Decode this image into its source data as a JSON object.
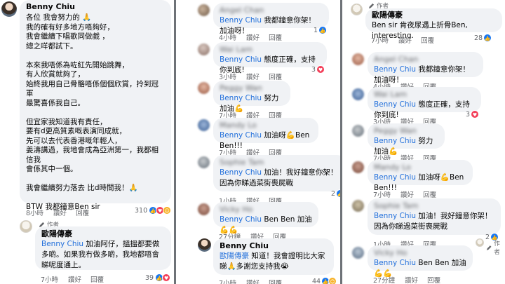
{
  "colors": {
    "mention": "#216fdb",
    "bubble": "#f0f2f5",
    "meta": "#65676b",
    "divider": "#6e7277"
  },
  "panel1": {
    "post": {
      "author": "Benny Chiu",
      "lines": [
        "各位 我會努力的 🙏",
        "我的確有好多地方唔夠好，",
        "我會繼續下唱歌同做戲 ，",
        "總之咩都試下。",
        "",
        "本來我唔係為咗紅先開始跳舞，",
        "有人欣賞就夠了，",
        "始終我用自己骨骼唔係個個欣賞，拎到冠軍",
        "最驚喜係我自己。",
        "",
        "但宜家我知道我有責任，",
        "要有d更高質素嘅表演同成就，",
        "先可以去代表香港嘅年輕人，",
        "姜濤講過，我地會成為亞洲第一，我都相信我",
        "會係其中一個。",
        "",
        "我會繼續努力落去 比d時間我！🙏",
        "",
        "BTW 我都鐘意Ben sir"
      ],
      "time": "8小時",
      "like": "讚好",
      "reply": "回覆",
      "count": "310"
    },
    "reply": {
      "badge": "作者",
      "name": "歐陽傳豪",
      "mention": "Benny Chiu",
      "text": " 加油阿仔，搵搵都要做多啲。如果我冇做多啲，我地都唔會睇呢度通上。",
      "time": "7小時",
      "like": "讚好",
      "reply": "回覆",
      "count": "39"
    }
  },
  "panel2": {
    "comments": [
      {
        "name": "Angel Chan",
        "mention": "Benny Chiu",
        "text": " 我都鐘意你架！加油呀！",
        "time": "4小時",
        "count": "1"
      },
      {
        "name": "Wai Lam",
        "mention": "Benny Chiu",
        "text": " 態度正確，支持你到底!",
        "time": "3小時",
        "count": "3"
      },
      {
        "name": "Peggy Wan",
        "mention": "Benny Chiu",
        "text": " 努力加油💪",
        "time": "7小時",
        "count": ""
      },
      {
        "name": "Mandy Lo",
        "mention": "Benny Chiu",
        "text": " 加油呀💪Ben Ben!!!",
        "time": "7小時",
        "count": ""
      },
      {
        "name": "Sophie Tam",
        "mention": "Benny Chiu",
        "text": " 加油！我好鐘意你架！因為你睇過菜街喪屍戰",
        "time": "1小時",
        "count": "2"
      },
      {
        "name": "Vicky Ho",
        "mention": "Benny Chiu",
        "text": " Ben Ben 加油💪💪",
        "time": "27分鐘",
        "count": ""
      }
    ],
    "author_reply": {
      "name": "Benny Chiu",
      "mention": "歐陽傳豪",
      "text": " 知道！我會證明比大家睇🙏多謝您支持我😭",
      "time": "7小時",
      "count": "44"
    },
    "like": "讚好",
    "reply": "回覆"
  },
  "panel3": {
    "top": {
      "badge": "作者",
      "name": "歐陽傳豪",
      "text": "Ben sir 肯夜尿遇上折骨Ben, interesting.",
      "time": "7小時",
      "count": "28"
    },
    "comments": [
      {
        "name": "Angel Chan",
        "mention": "Benny Chiu",
        "text": " 我都鐘意你架！加油呀！",
        "time": "4小時",
        "count": ""
      },
      {
        "name": "Wai Lam",
        "mention": "Benny Chiu",
        "text": " 態度正確，支持你到底!",
        "time": "3小時",
        "count": "3"
      },
      {
        "name": "Peggy Wan",
        "mention": "Benny Chiu",
        "text": " 努力加油💪",
        "time": "7小時",
        "count": ""
      },
      {
        "name": "Mandy Lo",
        "mention": "Benny Chiu",
        "text": " 加油呀💪Ben Ben!!!",
        "time": "7小時",
        "count": ""
      },
      {
        "name": "Sophie Tam",
        "mention": "Benny Chiu",
        "text": " 加油！我好鐘意你架！因為你睇過菜街喪屍戰",
        "time": "1小時",
        "count": "2"
      },
      {
        "name": "Vicky Ho",
        "mention": "Benny Chiu",
        "text": " Ben Ben 加油💪💪",
        "time": "27分鐘",
        "count": ""
      }
    ],
    "badge2": "作者",
    "like": "讚好",
    "reply": "回覆"
  }
}
